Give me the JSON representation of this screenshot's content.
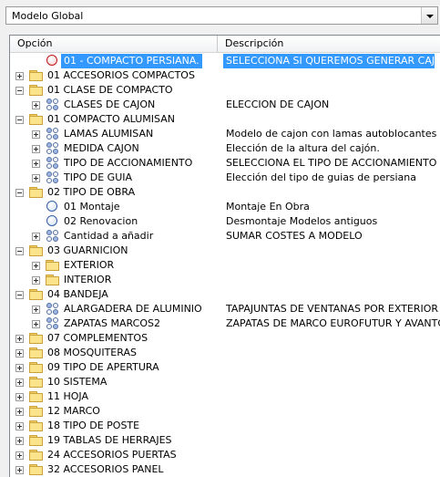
{
  "dropdown": {
    "selected": "Modelo Global"
  },
  "tree": {
    "headers": {
      "option": "Opción",
      "description": "Descripción"
    },
    "rows": [
      {
        "label": "01 - COMPACTO PERSIANA.",
        "desc": "SELECCIONA SI QUEREMOS GENERAR CAJON",
        "icon": "radio-red",
        "level": 1,
        "expander": "none",
        "selected": true
      },
      {
        "label": "01 ACCESORIOS COMPACTOS",
        "desc": "",
        "icon": "folder",
        "level": 0,
        "expander": "closed"
      },
      {
        "label": "01 CLASE DE COMPACTO",
        "desc": "",
        "icon": "folder",
        "level": 0,
        "expander": "open"
      },
      {
        "label": "CLASES DE CAJON",
        "desc": "ELECCION DE  CAJON",
        "icon": "grid",
        "level": 1,
        "expander": "closed"
      },
      {
        "label": "01 COMPACTO ALUMISAN",
        "desc": "",
        "icon": "folder",
        "level": 0,
        "expander": "open"
      },
      {
        "label": "LAMAS ALUMISAN",
        "desc": "Modelo de cajon con lamas autoblocantes",
        "icon": "grid",
        "level": 1,
        "expander": "closed"
      },
      {
        "label": "MEDIDA CAJON",
        "desc": "Elección de la altura del cajón.",
        "icon": "grid",
        "level": 1,
        "expander": "closed"
      },
      {
        "label": "TIPO DE ACCIONAMIENTO",
        "desc": "SELECCIONA EL TIPO DE ACCIONAMIENTO",
        "icon": "grid",
        "level": 1,
        "expander": "closed"
      },
      {
        "label": "TIPO DE GUIA",
        "desc": "Elección del tipo de guias de persiana",
        "icon": "grid",
        "level": 1,
        "expander": "closed"
      },
      {
        "label": "02 TIPO DE OBRA",
        "desc": "",
        "icon": "folder",
        "level": 0,
        "expander": "open"
      },
      {
        "label": "01 Montaje",
        "desc": "Montaje En Obra",
        "icon": "radio",
        "level": 1,
        "expander": "none"
      },
      {
        "label": "02 Renovacion",
        "desc": "Desmontaje Modelos antiguos",
        "icon": "radio",
        "level": 1,
        "expander": "none"
      },
      {
        "label": "Cantidad a añadir",
        "desc": "SUMAR COSTES A MODELO",
        "icon": "grid",
        "level": 1,
        "expander": "closed"
      },
      {
        "label": "03 GUARNICION",
        "desc": "",
        "icon": "folder",
        "level": 0,
        "expander": "open"
      },
      {
        "label": "EXTERIOR",
        "desc": "",
        "icon": "folder",
        "level": 1,
        "expander": "closed"
      },
      {
        "label": "INTERIOR",
        "desc": "",
        "icon": "folder",
        "level": 1,
        "expander": "closed"
      },
      {
        "label": "04 BANDEJA",
        "desc": "",
        "icon": "folder",
        "level": 0,
        "expander": "open"
      },
      {
        "label": "ALARGADERA DE ALUMINIO",
        "desc": "TAPAJUNTAS DE VENTANAS POR EXTERIOR",
        "icon": "grid",
        "level": 1,
        "expander": "closed"
      },
      {
        "label": "ZAPATAS MARCOS2",
        "desc": "ZAPATAS DE MARCO EUROFUTUR Y AVANTG",
        "icon": "grid",
        "level": 1,
        "expander": "closed"
      },
      {
        "label": "07 COMPLEMENTOS",
        "desc": "",
        "icon": "folder",
        "level": 0,
        "expander": "closed"
      },
      {
        "label": "08 MOSQUITERAS",
        "desc": "",
        "icon": "folder",
        "level": 0,
        "expander": "closed"
      },
      {
        "label": "09 TIPO DE APERTURA",
        "desc": "",
        "icon": "folder",
        "level": 0,
        "expander": "closed"
      },
      {
        "label": "10 SISTEMA",
        "desc": "",
        "icon": "folder",
        "level": 0,
        "expander": "closed"
      },
      {
        "label": "11 HOJA",
        "desc": "",
        "icon": "folder",
        "level": 0,
        "expander": "closed"
      },
      {
        "label": "12 MARCO",
        "desc": "",
        "icon": "folder",
        "level": 0,
        "expander": "closed"
      },
      {
        "label": "18 TIPO DE POSTE",
        "desc": "",
        "icon": "folder",
        "level": 0,
        "expander": "closed"
      },
      {
        "label": "19 TABLAS DE HERRAJES",
        "desc": "",
        "icon": "folder",
        "level": 0,
        "expander": "closed"
      },
      {
        "label": "24 ACCESORIOS PUERTAS",
        "desc": "",
        "icon": "folder",
        "level": 0,
        "expander": "closed"
      },
      {
        "label": "32 ACCESORIOS PANEL",
        "desc": "",
        "icon": "folder",
        "level": 0,
        "expander": "closed"
      }
    ]
  }
}
